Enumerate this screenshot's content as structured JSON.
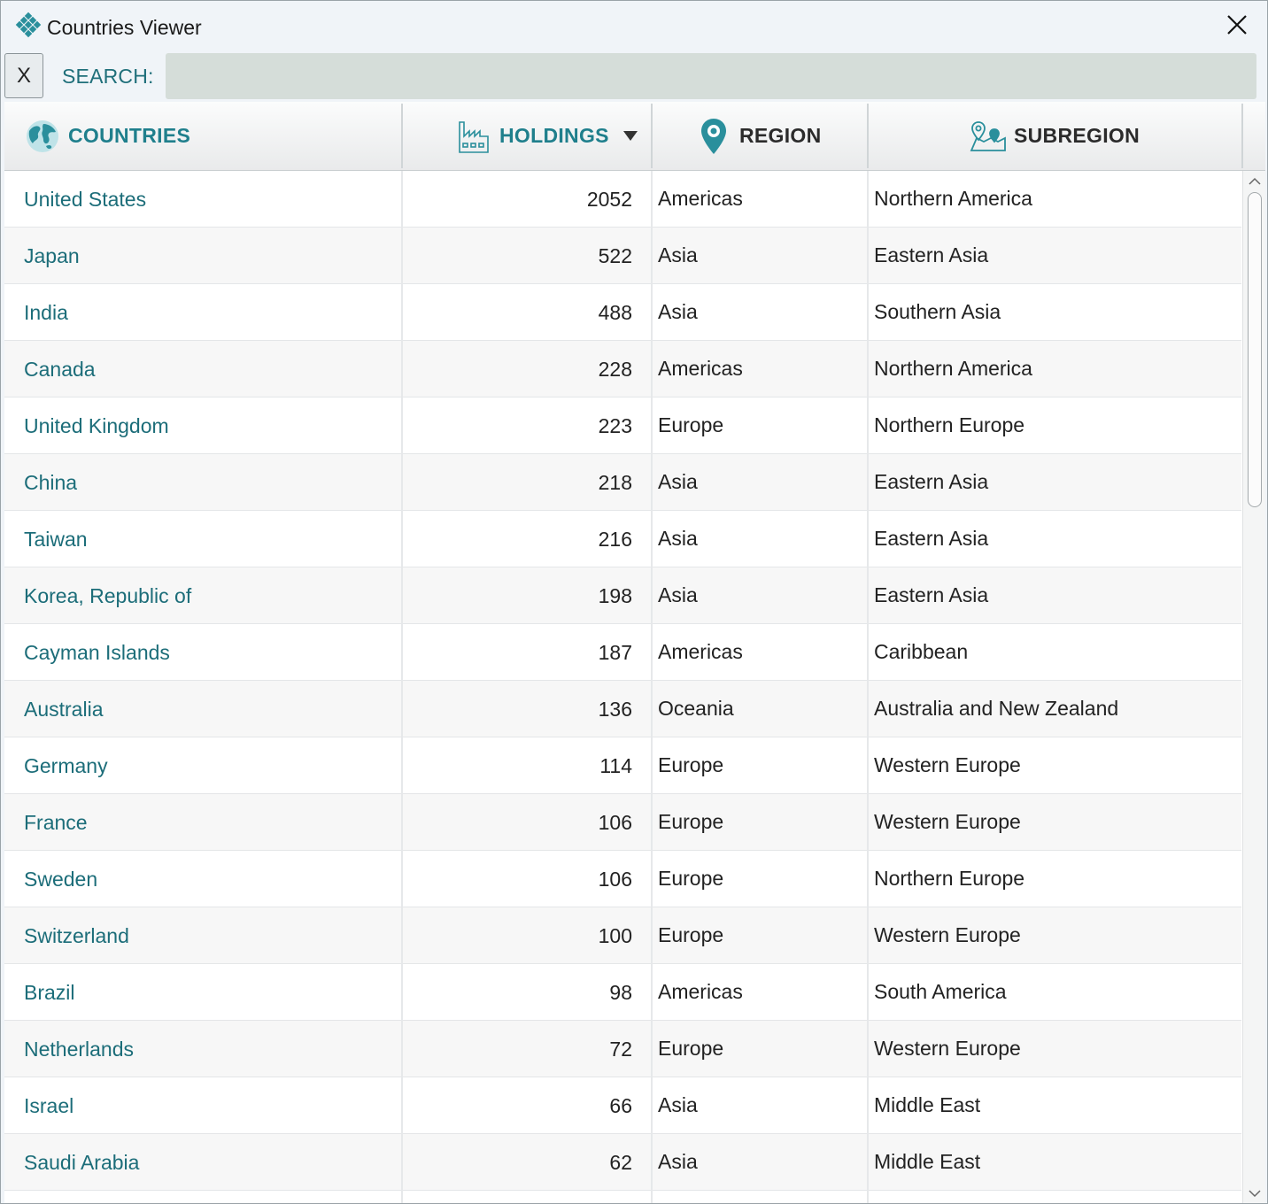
{
  "window": {
    "title": "Countries Viewer",
    "close_icon": "close-icon",
    "app_icon": "diamond-grid-icon"
  },
  "search": {
    "clear_label": "X",
    "label": "SEARCH:",
    "value": "",
    "placeholder": ""
  },
  "columns": [
    {
      "label": "COUNTRIES",
      "icon": "globe-icon"
    },
    {
      "label": "HOLDINGS",
      "icon": "factory-icon",
      "sort": "descending"
    },
    {
      "label": "REGION",
      "icon": "map-pin-icon"
    },
    {
      "label": "SUBREGION",
      "icon": "map-location-icon"
    }
  ],
  "rows": [
    {
      "country": "United States",
      "holdings": "2052",
      "region": "Americas",
      "subregion": "Northern America"
    },
    {
      "country": "Japan",
      "holdings": "522",
      "region": "Asia",
      "subregion": "Eastern Asia"
    },
    {
      "country": "India",
      "holdings": "488",
      "region": "Asia",
      "subregion": "Southern Asia"
    },
    {
      "country": "Canada",
      "holdings": "228",
      "region": "Americas",
      "subregion": "Northern America"
    },
    {
      "country": "United Kingdom",
      "holdings": "223",
      "region": "Europe",
      "subregion": "Northern Europe"
    },
    {
      "country": "China",
      "holdings": "218",
      "region": "Asia",
      "subregion": "Eastern Asia"
    },
    {
      "country": "Taiwan",
      "holdings": "216",
      "region": "Asia",
      "subregion": "Eastern Asia"
    },
    {
      "country": "Korea, Republic of",
      "holdings": "198",
      "region": "Asia",
      "subregion": "Eastern Asia"
    },
    {
      "country": "Cayman Islands",
      "holdings": "187",
      "region": "Americas",
      "subregion": "Caribbean"
    },
    {
      "country": "Australia",
      "holdings": "136",
      "region": "Oceania",
      "subregion": "Australia and New Zealand"
    },
    {
      "country": "Germany",
      "holdings": "114",
      "region": "Europe",
      "subregion": "Western Europe"
    },
    {
      "country": "France",
      "holdings": "106",
      "region": "Europe",
      "subregion": "Western Europe"
    },
    {
      "country": "Sweden",
      "holdings": "106",
      "region": "Europe",
      "subregion": "Northern Europe"
    },
    {
      "country": "Switzerland",
      "holdings": "100",
      "region": "Europe",
      "subregion": "Western Europe"
    },
    {
      "country": "Brazil",
      "holdings": "98",
      "region": "Americas",
      "subregion": "South America"
    },
    {
      "country": "Netherlands",
      "holdings": "72",
      "region": "Europe",
      "subregion": "Western Europe"
    },
    {
      "country": "Israel",
      "holdings": "66",
      "region": "Asia",
      "subregion": "Middle East"
    },
    {
      "country": "Saudi Arabia",
      "holdings": "62",
      "region": "Asia",
      "subregion": "Middle East"
    }
  ],
  "colors": {
    "accent": "#1c6d79",
    "header_text": "#1f6f7a",
    "search_bg": "#d5ddd9"
  }
}
